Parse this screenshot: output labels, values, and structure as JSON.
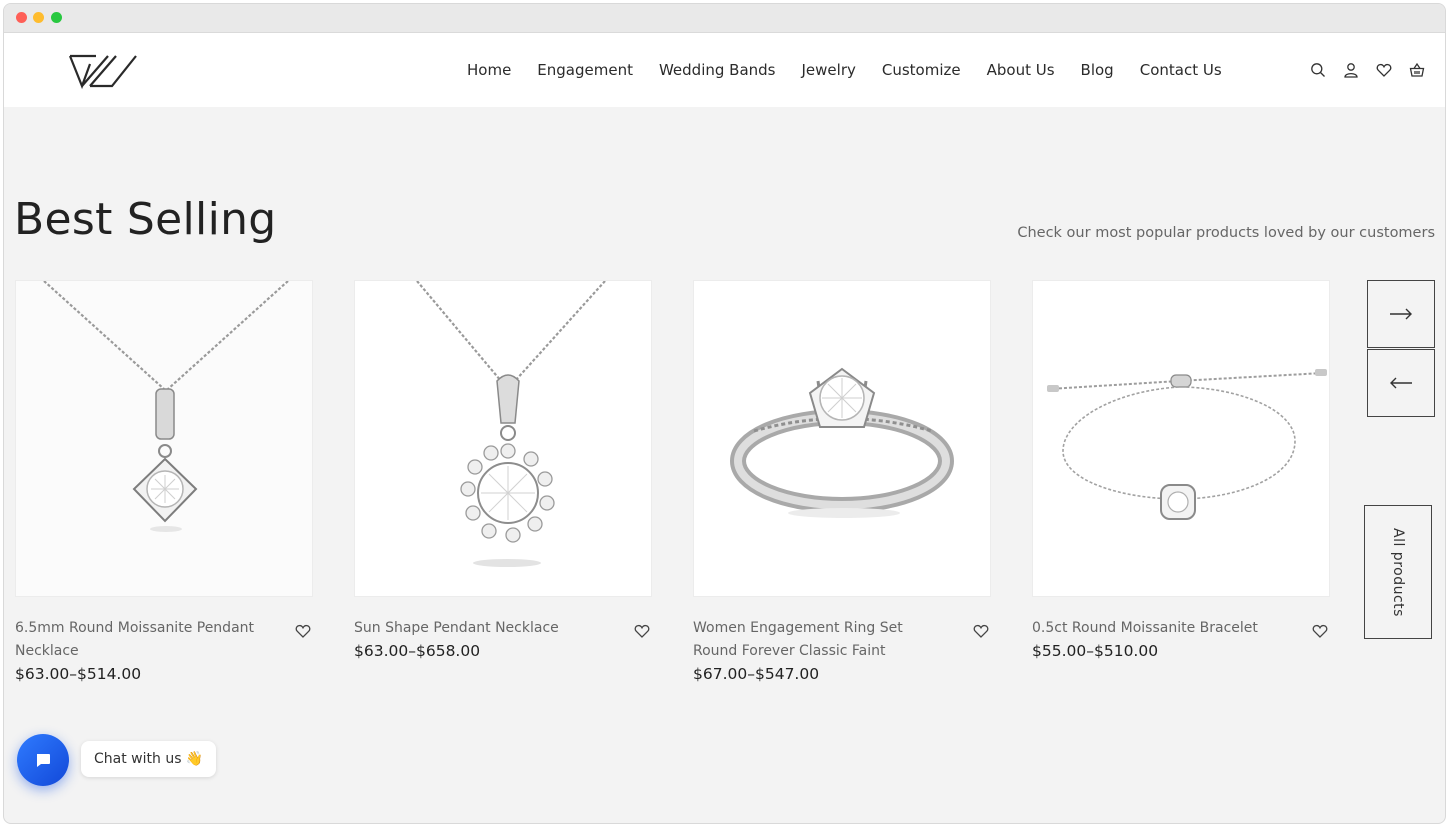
{
  "brand": {
    "logo_text": "W"
  },
  "nav": {
    "items": [
      {
        "label": "Home"
      },
      {
        "label": "Engagement"
      },
      {
        "label": "Wedding Bands"
      },
      {
        "label": "Jewelry"
      },
      {
        "label": "Customize"
      },
      {
        "label": "About Us"
      },
      {
        "label": "Blog"
      },
      {
        "label": "Contact Us"
      }
    ]
  },
  "header_icons": [
    "search-icon",
    "user-icon",
    "heart-icon",
    "basket-icon"
  ],
  "section": {
    "title": "Best Selling",
    "subtitle": "Check our most popular products loved by our customers"
  },
  "products": [
    {
      "name": "6.5mm Round Moissanite Pendant Necklace",
      "price": "$63.00–$514.00",
      "image": "pendant-necklace"
    },
    {
      "name": "Sun Shape Pendant Necklace",
      "price": "$63.00–$658.00",
      "image": "sun-pendant-necklace"
    },
    {
      "name": "Women Engagement Ring Set Round Forever Classic Faint",
      "price": "$67.00–$547.00",
      "image": "engagement-ring"
    },
    {
      "name": "0.5ct Round Moissanite Bracelet",
      "price": "$55.00–$510.00",
      "image": "bracelet"
    }
  ],
  "carousel": {
    "next_icon": "arrow-right-icon",
    "prev_icon": "arrow-left-icon",
    "all_products_label": "All products"
  },
  "chat": {
    "label": "Chat with us 👋"
  },
  "colors": {
    "accent": "#1f5eea",
    "background": "#f3f3f3",
    "text": "#222222"
  }
}
